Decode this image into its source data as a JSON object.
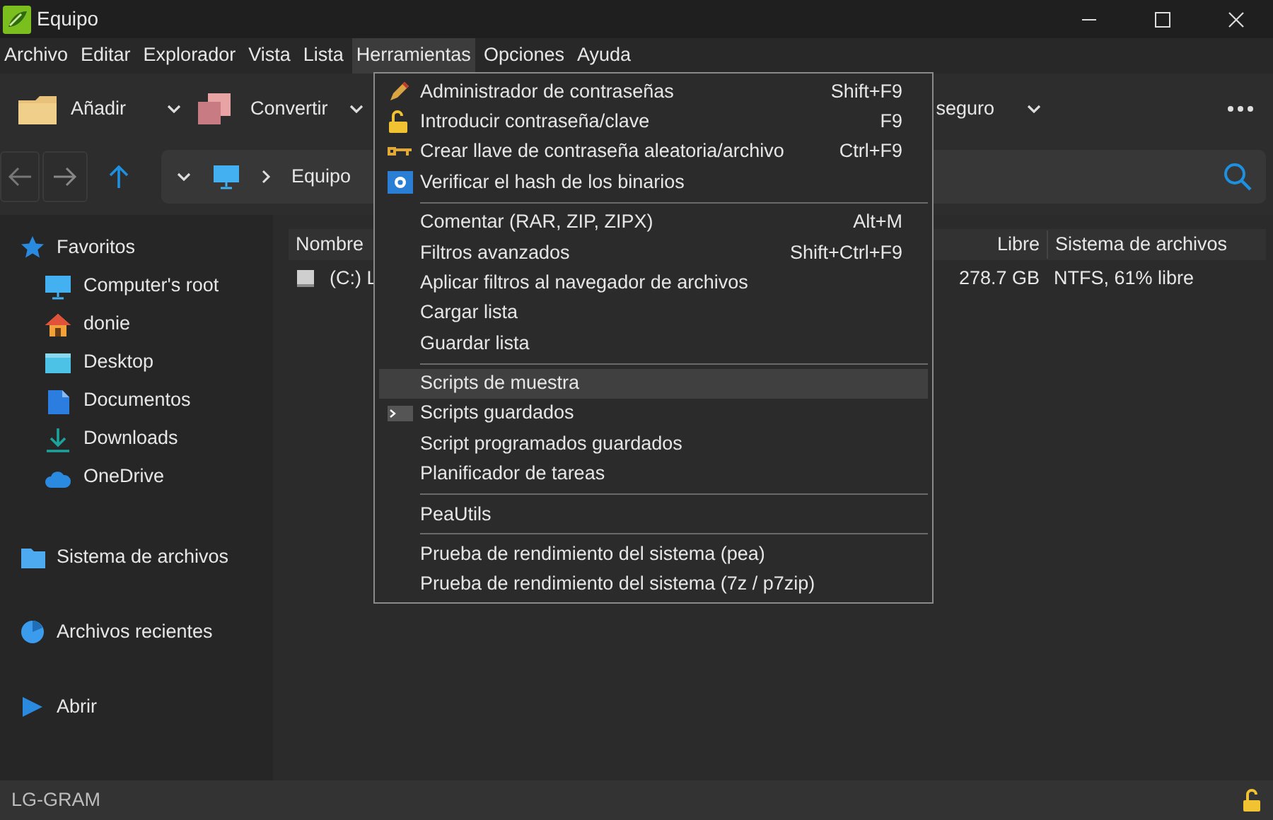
{
  "window": {
    "title": "Equipo"
  },
  "menu_bar": [
    {
      "label": "Archivo",
      "selected": false
    },
    {
      "label": "Editar",
      "selected": false
    },
    {
      "label": "Explorador",
      "selected": false
    },
    {
      "label": "Vista",
      "selected": false
    },
    {
      "label": "Lista",
      "selected": false
    },
    {
      "label": "Herramientas",
      "selected": true
    },
    {
      "label": "Opciones",
      "selected": false
    },
    {
      "label": "Ayuda",
      "selected": false
    }
  ],
  "toolbar": {
    "buttons": [
      {
        "label": "Añadir"
      },
      {
        "label": "Convertir"
      },
      {
        "label": "seguro"
      }
    ]
  },
  "address_bar": {
    "path": [
      "Equipo"
    ]
  },
  "sidebar": {
    "items": [
      {
        "label": "Favoritos",
        "children": [
          {
            "label": "Computer's root"
          },
          {
            "label": "donie"
          },
          {
            "label": "Desktop"
          },
          {
            "label": "Documentos"
          },
          {
            "label": "Downloads"
          },
          {
            "label": "OneDrive"
          }
        ]
      },
      {
        "label": "Sistema de archivos"
      },
      {
        "label": "Archivos recientes"
      },
      {
        "label": "Abrir"
      }
    ]
  },
  "table": {
    "columns": [
      "Nombre",
      "Libre",
      "Sistema de archivos"
    ],
    "rows": [
      [
        "(C:) L",
        "278.7 GB",
        "NTFS, 61% libre"
      ]
    ]
  },
  "menu": {
    "items": [
      {
        "kind": "item",
        "label": "Administrador de contraseñas",
        "shortcut": "Shift+F9",
        "selected": false
      },
      {
        "kind": "item",
        "label": "Introducir contraseña/clave",
        "shortcut": "F9",
        "selected": false
      },
      {
        "kind": "item",
        "label": "Crear llave de contraseña aleatoria/archivo",
        "shortcut": "Ctrl+F9",
        "selected": false
      },
      {
        "kind": "item",
        "label": "Verificar el hash de los binarios",
        "selected": false
      },
      {
        "kind": "separator"
      },
      {
        "kind": "item",
        "label": "Comentar (RAR, ZIP, ZIPX)",
        "shortcut": "Alt+M",
        "selected": false
      },
      {
        "kind": "item",
        "label": "Filtros avanzados",
        "shortcut": "Shift+Ctrl+F9",
        "selected": false
      },
      {
        "kind": "item",
        "label": "Aplicar filtros al navegador de archivos",
        "selected": false
      },
      {
        "kind": "item",
        "label": "Cargar lista",
        "selected": false
      },
      {
        "kind": "item",
        "label": "Guardar lista",
        "selected": false
      },
      {
        "kind": "separator"
      },
      {
        "kind": "item",
        "label": "Scripts de muestra",
        "selected": true
      },
      {
        "kind": "item",
        "label": "Scripts guardados",
        "selected": false
      },
      {
        "kind": "item",
        "label": "Script programados guardados",
        "selected": false
      },
      {
        "kind": "item",
        "label": "Planificador de tareas",
        "selected": false
      },
      {
        "kind": "separator"
      },
      {
        "kind": "item",
        "label": "PeaUtils",
        "selected": false
      },
      {
        "kind": "separator"
      },
      {
        "kind": "item",
        "label": "Prueba de rendimiento del sistema (pea)",
        "selected": false
      },
      {
        "kind": "item",
        "label": "Prueba de rendimiento del sistema (7z / p7zip)",
        "selected": false
      }
    ]
  },
  "status_bar": {
    "text": "LG-GRAM"
  }
}
